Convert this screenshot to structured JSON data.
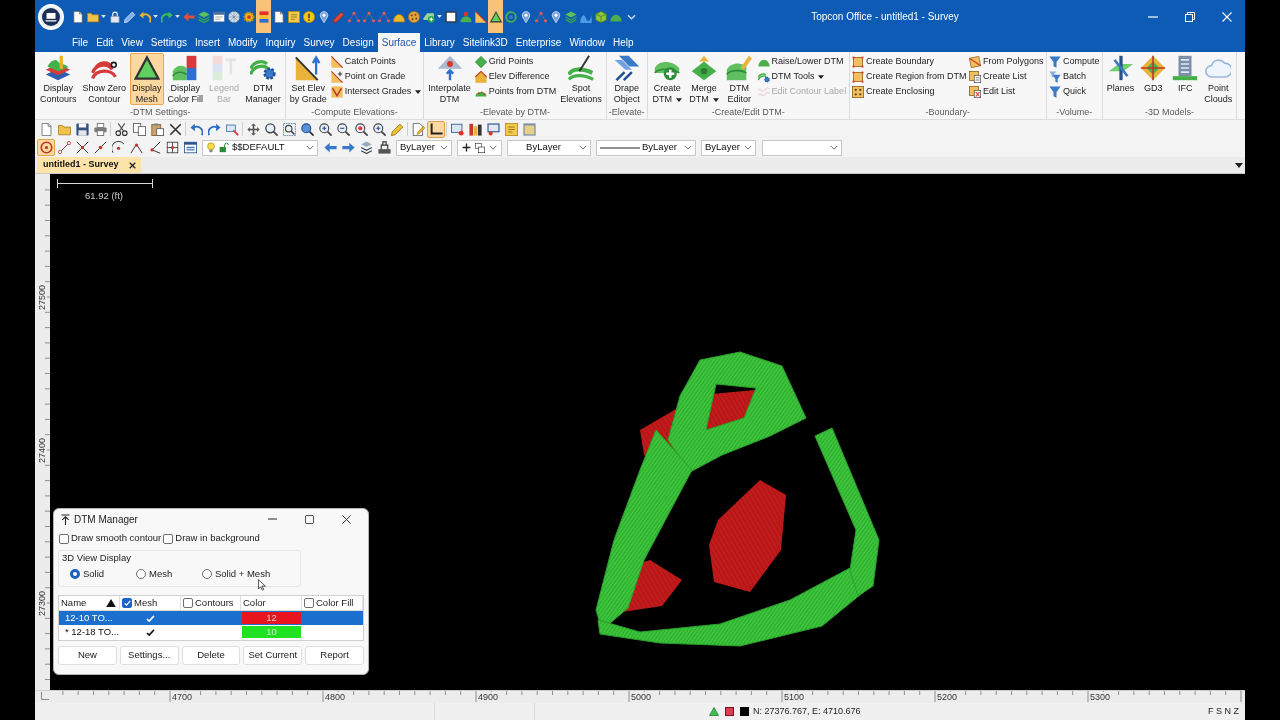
{
  "window": {
    "title": "Topcon Office - untitled1 - Survey"
  },
  "quick_access_toolbar": [
    {
      "on": false
    },
    {
      "on": false
    },
    {
      "on": false
    },
    {
      "on": false
    },
    {
      "on": false
    },
    {
      "on": false
    },
    {
      "on": false
    },
    {
      "on": false
    },
    {
      "on": false
    },
    {
      "on": false
    },
    {
      "on": false
    },
    {
      "on": true
    },
    {
      "on": false
    },
    {
      "on": false
    },
    {
      "on": false
    },
    {
      "on": false
    },
    {
      "on": false
    },
    {
      "on": false
    },
    {
      "on": false
    },
    {
      "on": false
    },
    {
      "on": false
    },
    {
      "on": false
    },
    {
      "on": false
    },
    {
      "on": false
    },
    {
      "on": false
    },
    {
      "on": false
    },
    {
      "on": true
    },
    {
      "on": false
    },
    {
      "on": false
    },
    {
      "on": false
    },
    {
      "on": false
    },
    {
      "on": false
    },
    {
      "on": false
    },
    {
      "on": false
    },
    {
      "on": false
    }
  ],
  "menu_bar": [
    {
      "label": "File",
      "selected": false
    },
    {
      "label": "Edit",
      "selected": false
    },
    {
      "label": "View",
      "selected": false
    },
    {
      "label": "Settings",
      "selected": false
    },
    {
      "label": "Insert",
      "selected": false
    },
    {
      "label": "Modify",
      "selected": false
    },
    {
      "label": "Inquiry",
      "selected": false
    },
    {
      "label": "Survey",
      "selected": false
    },
    {
      "label": "Design",
      "selected": false
    },
    {
      "label": "Surface",
      "selected": true
    },
    {
      "label": "Library",
      "selected": false
    },
    {
      "label": "Sitelink3D",
      "selected": false
    },
    {
      "label": "Enterprise",
      "selected": false
    },
    {
      "label": "Window",
      "selected": false
    },
    {
      "label": "Help",
      "selected": false
    }
  ],
  "ribbon": [
    {
      "label": "-DTM Settings-",
      "items": [
        {
          "kind": "large",
          "lines": [
            "Display",
            "Contours"
          ],
          "on": false,
          "disabled": false,
          "dropdown": false
        },
        {
          "kind": "large",
          "lines": [
            "Show Zero",
            "Contour"
          ],
          "on": false,
          "disabled": false,
          "dropdown": false
        },
        {
          "kind": "large",
          "lines": [
            "Display",
            "Mesh"
          ],
          "on": true,
          "disabled": false,
          "dropdown": false
        },
        {
          "kind": "large",
          "lines": [
            "Display",
            "Color Fill"
          ],
          "on": false,
          "disabled": false,
          "dropdown": false
        },
        {
          "kind": "large",
          "lines": [
            "Legend",
            "Bar"
          ],
          "on": false,
          "disabled": true,
          "dropdown": false
        },
        {
          "kind": "large",
          "lines": [
            "DTM",
            "Manager"
          ],
          "on": false,
          "disabled": false,
          "dropdown": false
        }
      ]
    },
    {
      "label": "-Compute Elevations-",
      "items": [
        {
          "kind": "large",
          "lines": [
            "Set Elev",
            "by Grade"
          ],
          "disabled": false,
          "dropdown": false
        },
        {
          "kind": "stack",
          "items": [
            {
              "label": "Catch Points",
              "disabled": false,
              "dropdown": false
            },
            {
              "label": "Point on Grade",
              "disabled": false,
              "dropdown": false
            },
            {
              "label": "Intersect Grades",
              "disabled": false,
              "dropdown": true
            }
          ]
        }
      ]
    },
    {
      "label": "-Elevate by DTM-",
      "items": [
        {
          "kind": "large",
          "lines": [
            "Interpolate",
            "DTM"
          ],
          "disabled": false,
          "dropdown": false
        },
        {
          "kind": "stack",
          "items": [
            {
              "label": "Grid Points",
              "disabled": false,
              "dropdown": false
            },
            {
              "label": "Elev Difference",
              "disabled": false,
              "dropdown": false
            },
            {
              "label": "Points from DTM",
              "disabled": false,
              "dropdown": false
            }
          ]
        },
        {
          "kind": "large",
          "lines": [
            "Spot",
            "Elevations"
          ],
          "disabled": false,
          "dropdown": false
        }
      ]
    },
    {
      "label": "-Elevate-",
      "items": [
        {
          "kind": "large",
          "lines": [
            "Drape",
            "Object"
          ],
          "disabled": false,
          "dropdown": false
        }
      ]
    },
    {
      "label": "-Create/Edit DTM-",
      "items": [
        {
          "kind": "large",
          "lines": [
            "Create",
            "DTM"
          ],
          "disabled": false,
          "dropdown": true
        },
        {
          "kind": "large",
          "lines": [
            "Merge",
            "DTM"
          ],
          "disabled": false,
          "dropdown": true
        },
        {
          "kind": "large",
          "lines": [
            "DTM",
            "Editor"
          ],
          "disabled": false,
          "dropdown": false
        },
        {
          "kind": "stack",
          "items": [
            {
              "label": "Raise/Lower DTM",
              "disabled": false,
              "dropdown": false
            },
            {
              "label": "DTM Tools",
              "disabled": false,
              "dropdown": true
            },
            {
              "label": "Edit Contour Label",
              "disabled": true,
              "dropdown": false
            }
          ]
        }
      ]
    },
    {
      "label": "-Boundary-",
      "items": [
        {
          "kind": "stack",
          "items": [
            {
              "label": "Create Boundary",
              "disabled": false,
              "dropdown": false
            },
            {
              "label": "Create Region from DTM",
              "disabled": false,
              "dropdown": false
            },
            {
              "label": "Create Enclosing",
              "disabled": false,
              "dropdown": false
            }
          ]
        },
        {
          "kind": "stack",
          "items": [
            {
              "label": "From Polygons",
              "disabled": false,
              "dropdown": false
            },
            {
              "label": "Create List",
              "disabled": false,
              "dropdown": false
            },
            {
              "label": "Edit List",
              "disabled": false,
              "dropdown": false
            }
          ]
        }
      ]
    },
    {
      "label": "-Volume-",
      "items": [
        {
          "kind": "stack",
          "items": [
            {
              "label": "Compute",
              "disabled": false,
              "dropdown": false
            },
            {
              "label": "Batch",
              "disabled": false,
              "dropdown": false
            },
            {
              "label": "Quick",
              "disabled": false,
              "dropdown": false
            }
          ]
        }
      ]
    },
    {
      "label": "-3D Models-",
      "items": [
        {
          "kind": "large",
          "lines": [
            "Planes"
          ],
          "disabled": false,
          "dropdown": false
        },
        {
          "kind": "large",
          "lines": [
            "GD3"
          ],
          "disabled": false,
          "dropdown": false
        },
        {
          "kind": "large",
          "lines": [
            "IFC"
          ],
          "disabled": false,
          "dropdown": false
        },
        {
          "kind": "large",
          "lines": [
            "Point",
            "Clouds"
          ],
          "disabled": false,
          "dropdown": false
        }
      ]
    }
  ],
  "toolbar_1": [
    {
      "on": false
    },
    {
      "on": false
    },
    {
      "on": false
    },
    {
      "on": false
    },
    {
      "on": false
    },
    {
      "on": false
    },
    {
      "on": false
    },
    {
      "on": false
    },
    {
      "on": false
    },
    {
      "on": false
    },
    {
      "on": false
    },
    {
      "on": false
    },
    {
      "on": false
    },
    {
      "on": false
    },
    {
      "on": false
    },
    {
      "on": false
    },
    {
      "on": false
    },
    {
      "on": false
    },
    {
      "on": false
    },
    {
      "on": false
    },
    {
      "on": false
    },
    {
      "on": true
    },
    {
      "on": false
    },
    {
      "on": false
    },
    {
      "on": false
    },
    {
      "on": false
    },
    {
      "on": false
    }
  ],
  "toolbar_2": [
    {
      "kind": "icon",
      "on": true
    },
    {
      "kind": "icon",
      "on": false
    },
    {
      "kind": "icon",
      "on": false
    },
    {
      "kind": "icon",
      "on": false
    },
    {
      "kind": "icon",
      "on": false
    },
    {
      "kind": "icon",
      "on": false
    },
    {
      "kind": "icon",
      "on": false
    },
    {
      "kind": "icon",
      "on": false
    },
    {
      "kind": "icon",
      "on": false
    },
    {
      "kind": "combo",
      "value": "$$DEFAULT"
    },
    {
      "kind": "icon",
      "on": false
    },
    {
      "kind": "icon",
      "on": false
    },
    {
      "kind": "icon",
      "on": false
    },
    {
      "kind": "icon",
      "on": false
    },
    {
      "kind": "combo",
      "value": "ByLayer"
    },
    {
      "kind": "icon_menu"
    },
    {
      "kind": "combo",
      "value": "ByLayer"
    },
    {
      "kind": "linetype",
      "value": "ByLayer"
    },
    {
      "kind": "combo",
      "value": "ByLayer"
    },
    {
      "kind": "combo"
    }
  ],
  "document_tabs": [
    {
      "label": "untitled1 - Survey",
      "selected": true
    }
  ],
  "canvas": {
    "scale_bar": "61.92 (ft)",
    "y_ruler": [
      "27500",
      "27400",
      "27300"
    ],
    "x_ruler": [
      "4700",
      "4800",
      "4900",
      "5000",
      "5100",
      "5200",
      "5300"
    ]
  },
  "dtm_manager": {
    "title": "DTM Manager",
    "options": [
      {
        "label": "Draw smooth contour",
        "checked": false
      },
      {
        "label": "Draw in background",
        "checked": false
      }
    ],
    "view_display": {
      "label": "3D View Display",
      "options": [
        {
          "label": "Solid",
          "selected": true
        },
        {
          "label": "Mesh",
          "selected": false
        },
        {
          "label": "Solid + Mesh",
          "selected": false
        }
      ]
    },
    "columns": [
      {
        "kind": "sort",
        "label": "Name"
      },
      {
        "kind": "check",
        "label": "Mesh",
        "checked": true
      },
      {
        "kind": "check",
        "label": "Contours",
        "checked": false
      },
      {
        "kind": "plain",
        "label": "Color"
      },
      {
        "kind": "check",
        "label": "Color Fill",
        "checked": false
      }
    ],
    "rows": [
      {
        "name": "12-10 TO...",
        "mesh": true,
        "color": "#e8141e",
        "color_number": "12",
        "selected": true
      },
      {
        "name": "* 12-18 TO...",
        "mesh": true,
        "color": "#22e022",
        "color_number": "10",
        "selected": false
      }
    ],
    "buttons": [
      "New",
      "Settings...",
      "Delete",
      "Set Current",
      "Report"
    ]
  },
  "status_bar": {
    "coordinates": "N: 27376.767, E: 4710.676",
    "snap_modes": "F S N Z"
  }
}
